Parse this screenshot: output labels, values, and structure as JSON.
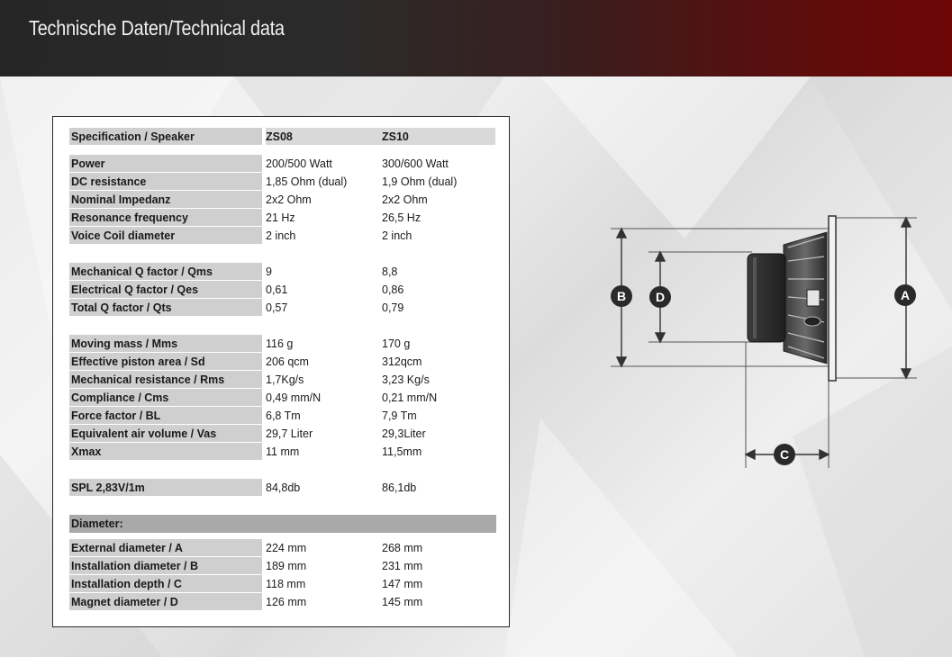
{
  "header": {
    "title": "Technische Daten/Technical data"
  },
  "table": {
    "column_headers": [
      "Specification / Speaker",
      "ZS08",
      "ZS10"
    ],
    "groups": [
      [
        [
          "Power",
          "200/500 Watt",
          "300/600 Watt"
        ],
        [
          "DC resistance",
          "1,85 Ohm (dual)",
          "1,9 Ohm (dual)"
        ],
        [
          "Nominal Impedanz",
          "2x2 Ohm",
          "2x2 Ohm"
        ],
        [
          "Resonance frequency",
          "21 Hz",
          "26,5 Hz"
        ],
        [
          "Voice Coil diameter",
          "2 inch",
          "2 inch"
        ]
      ],
      [
        [
          "Mechanical Q factor / Qms",
          "9",
          "8,8"
        ],
        [
          "Electrical Q factor / Qes",
          "0,61",
          "0,86"
        ],
        [
          "Total Q factor / Qts",
          "0,57",
          "0,79"
        ]
      ],
      [
        [
          "Moving mass / Mms",
          "116 g",
          "170 g"
        ],
        [
          "Effective piston area / Sd",
          "206 qcm",
          "312qcm"
        ],
        [
          "Mechanical resistance / Rms",
          "1,7Kg/s",
          "3,23 Kg/s"
        ],
        [
          "Compliance / Cms",
          "0,49 mm/N",
          "0,21 mm/N"
        ],
        [
          "Force factor / BL",
          "6,8 Tm",
          "7,9 Tm"
        ],
        [
          "Equivalent air volume / Vas",
          "29,7 Liter",
          "29,3Liter"
        ],
        [
          "Xmax",
          "11 mm",
          "11,5mm"
        ]
      ],
      [
        [
          "SPL 2,83V/1m",
          "84,8db",
          "86,1db"
        ]
      ]
    ],
    "diameter_heading": "Diameter:",
    "diameter_rows": [
      [
        "External diameter / A",
        "224 mm",
        "268 mm"
      ],
      [
        "Installation diameter / B",
        "189 mm",
        "231 mm"
      ],
      [
        "Installation depth / C",
        "118 mm",
        "147 mm"
      ],
      [
        "Magnet diameter / D",
        "126 mm",
        "145 mm"
      ]
    ]
  },
  "diagram": {
    "markers": [
      "A",
      "B",
      "C",
      "D"
    ]
  }
}
